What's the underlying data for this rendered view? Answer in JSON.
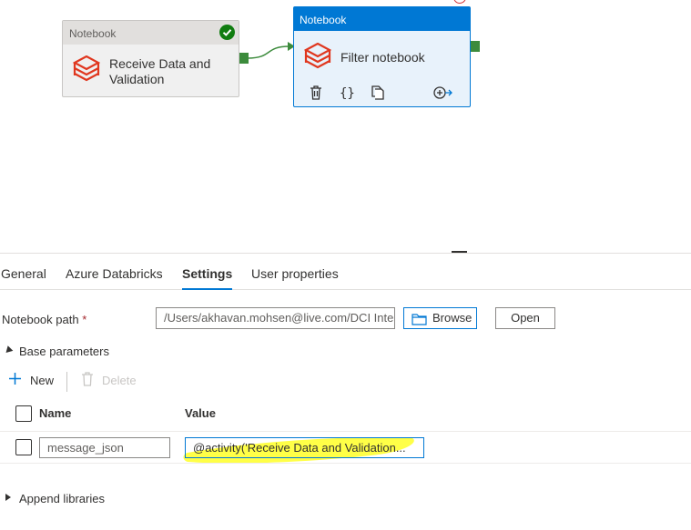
{
  "canvas": {
    "node1": {
      "header": "Notebook",
      "title_line1": "Receive Data and",
      "title_line2": "Validation",
      "status": "succeeded"
    },
    "node2": {
      "header": "Notebook",
      "title": "Filter notebook"
    },
    "colors": {
      "accent": "#0078d4",
      "success": "#107c10",
      "databricks": "#e0371f",
      "highlight": "#ffff33"
    }
  },
  "tabs": [
    "General",
    "Azure Databricks",
    "Settings",
    "User properties"
  ],
  "active_tab": "Settings",
  "settings": {
    "notebook_path_label": "Notebook path",
    "required_marker": "*",
    "notebook_path_value": "/Users/akhavan.mohsen@live.com/DCI Inte",
    "browse_label": "Browse",
    "open_label": "Open",
    "base_parameters_label": "Base parameters",
    "new_label": "New",
    "delete_label": "Delete",
    "col_name": "Name",
    "col_value": "Value",
    "param_name": "message_json",
    "param_value": "@activity('Receive Data and Validation...",
    "append_libraries_label": "Append libraries"
  }
}
